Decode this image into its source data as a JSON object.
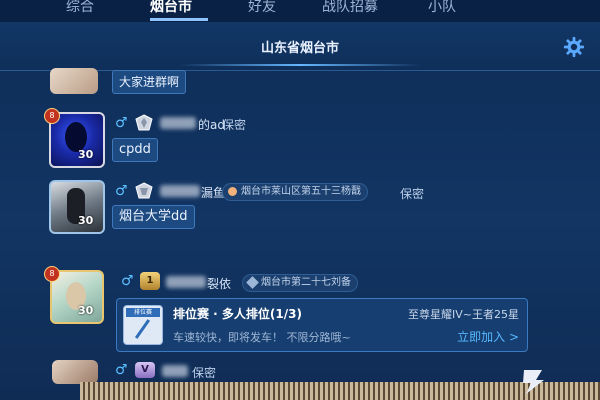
{
  "tabs": [
    {
      "label": "综合",
      "active": false
    },
    {
      "label": "烟台市",
      "active": true
    },
    {
      "label": "好友",
      "active": false
    },
    {
      "label": "战队招募",
      "active": false
    },
    {
      "label": "小队",
      "active": false
    }
  ],
  "header": {
    "title": "山东省烟台市"
  },
  "messages": [
    {
      "text": "大家进群啊"
    },
    {
      "level": "8",
      "avatar_badge": "30",
      "name_suffix": "的ad",
      "secret": "保密",
      "text": "cpdd"
    },
    {
      "avatar_badge": "30",
      "name_suffix": "漏鱼",
      "location": "烟台市莱山区第五十三杨戬",
      "secret": "保密",
      "text": "烟台大学dd"
    },
    {
      "level": "8",
      "rank_num": "1",
      "avatar_badge": "30",
      "name_suffix": "裂依",
      "location": "烟台市第二十七刘备",
      "card": {
        "badge": "排位赛",
        "title": "排位赛 · 多人排位(1/3)",
        "range": "至尊星耀IV~王者25星",
        "desc": "车速较快，即将发车！ 不限分路哦~",
        "join": "立即加入 >"
      }
    },
    {
      "rank_num": "V",
      "secret": "保密"
    }
  ],
  "colors": {
    "accent": "#67b7ff",
    "gender": "#5cc0ff",
    "join": "#58b8ff"
  }
}
